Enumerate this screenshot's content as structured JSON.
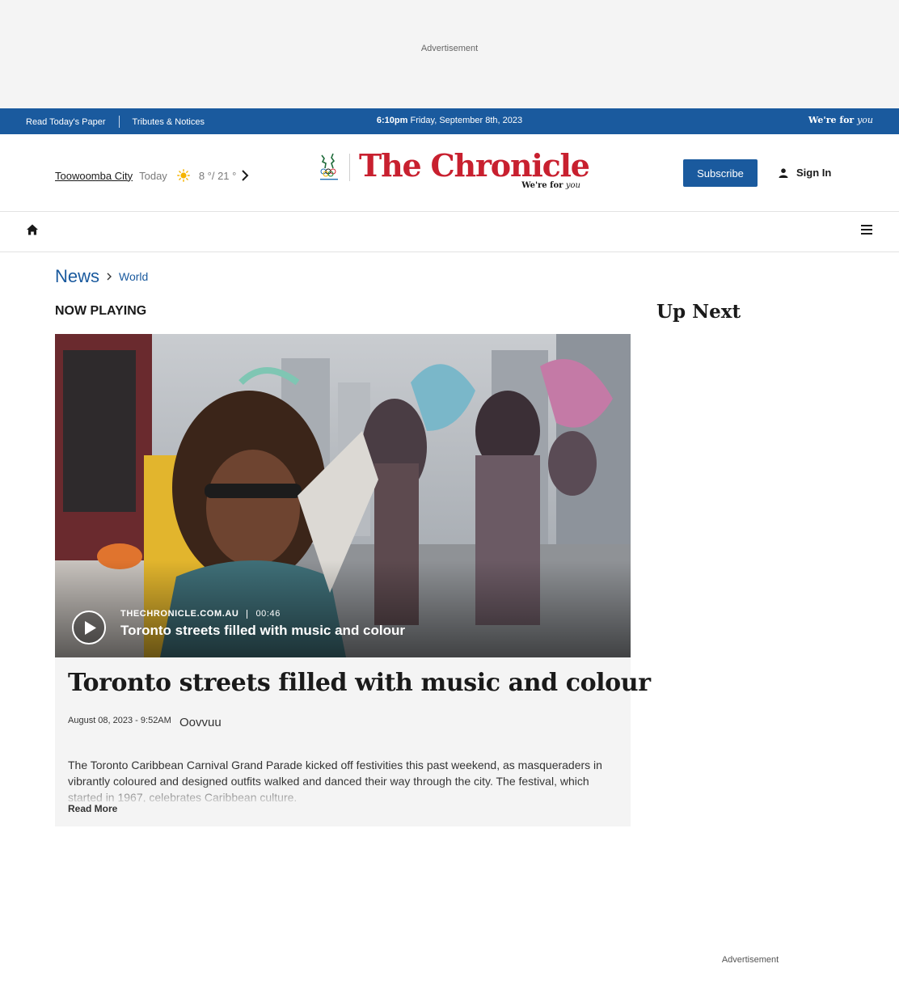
{
  "top_ad": {
    "label": "Advertisement"
  },
  "util_bar": {
    "read_paper": "Read Today's Paper",
    "tributes": "Tributes & Notices",
    "time": "6:10pm",
    "date": "Friday, September 8th, 2023",
    "tagline_main": "We're for",
    "tagline_script": "you"
  },
  "masthead": {
    "weather": {
      "city": "Toowoomba City",
      "day": "Today",
      "temps": "8 °/ 21 °",
      "icon": "sun-icon"
    },
    "logo": {
      "title": "The Chronicle",
      "sub_main": "We're for",
      "sub_script": "you"
    },
    "subscribe": "Subscribe",
    "sign_in": "Sign In"
  },
  "breadcrumb": {
    "section": "News",
    "subsection": "World"
  },
  "now_playing": "NOW PLAYING",
  "up_next": "Up Next",
  "video": {
    "source": "THECHRONICLE.COM.AU",
    "duration": "00:46",
    "title": "Toronto streets filled with music and colour"
  },
  "article": {
    "headline": "Toronto streets filled with music and colour",
    "date": "August 08, 2023 - 9:52AM",
    "author": "Oovvuu",
    "description": "The Toronto Caribbean Carnival Grand Parade kicked off festivities this past weekend, as masqueraders in vibrantly coloured and designed outfits walked and danced their way through the city. The festival, which started in 1967, celebrates Caribbean culture.",
    "read_more": "Read More"
  },
  "side_ad": {
    "label": "Advertisement"
  },
  "colors": {
    "brand_blue": "#1a5a9e",
    "logo_red": "#c8202f"
  }
}
